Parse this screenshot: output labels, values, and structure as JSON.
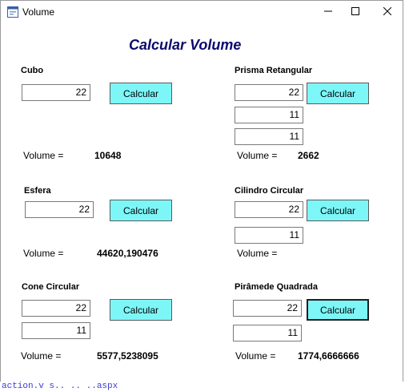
{
  "window": {
    "title": "Volume"
  },
  "form": {
    "heading": "Calcular Volume"
  },
  "sections": {
    "cubo": {
      "label": "Cubo",
      "inputs": [
        "22"
      ],
      "button": "Calcular",
      "volume_label": "Volume =",
      "volume_value": "10648"
    },
    "prisma": {
      "label": "Prisma Retangular",
      "inputs": [
        "22",
        "11",
        "11"
      ],
      "button": "Calcular",
      "volume_label": "Volume =",
      "volume_value": "2662"
    },
    "esfera": {
      "label": "Esfera",
      "inputs": [
        "22"
      ],
      "button": "Calcular",
      "volume_label": "Volume =",
      "volume_value": "44620,190476"
    },
    "cilindro": {
      "label": "Cilindro Circular",
      "inputs": [
        "22",
        "11"
      ],
      "button": "Calcular",
      "volume_label": "Volume =",
      "volume_value": ""
    },
    "cone": {
      "label": "Cone Circular",
      "inputs": [
        "22",
        "11"
      ],
      "button": "Calcular",
      "volume_label": "Volume =",
      "volume_value": "5577,5238095"
    },
    "piramide": {
      "label": "Pirâmede Quadrada",
      "inputs": [
        "22",
        "11"
      ],
      "button": "Calcular",
      "volume_label": "Volume =",
      "volume_value": "1774,6666666"
    }
  },
  "background_text": "action.v s.. .. ..aspx",
  "colors": {
    "button_bg": "#7df6f8",
    "heading": "#0a0a6e"
  },
  "icons": {
    "app": "form-icon",
    "minimize": "minimize-icon",
    "maximize": "maximize-icon",
    "close": "close-icon"
  }
}
